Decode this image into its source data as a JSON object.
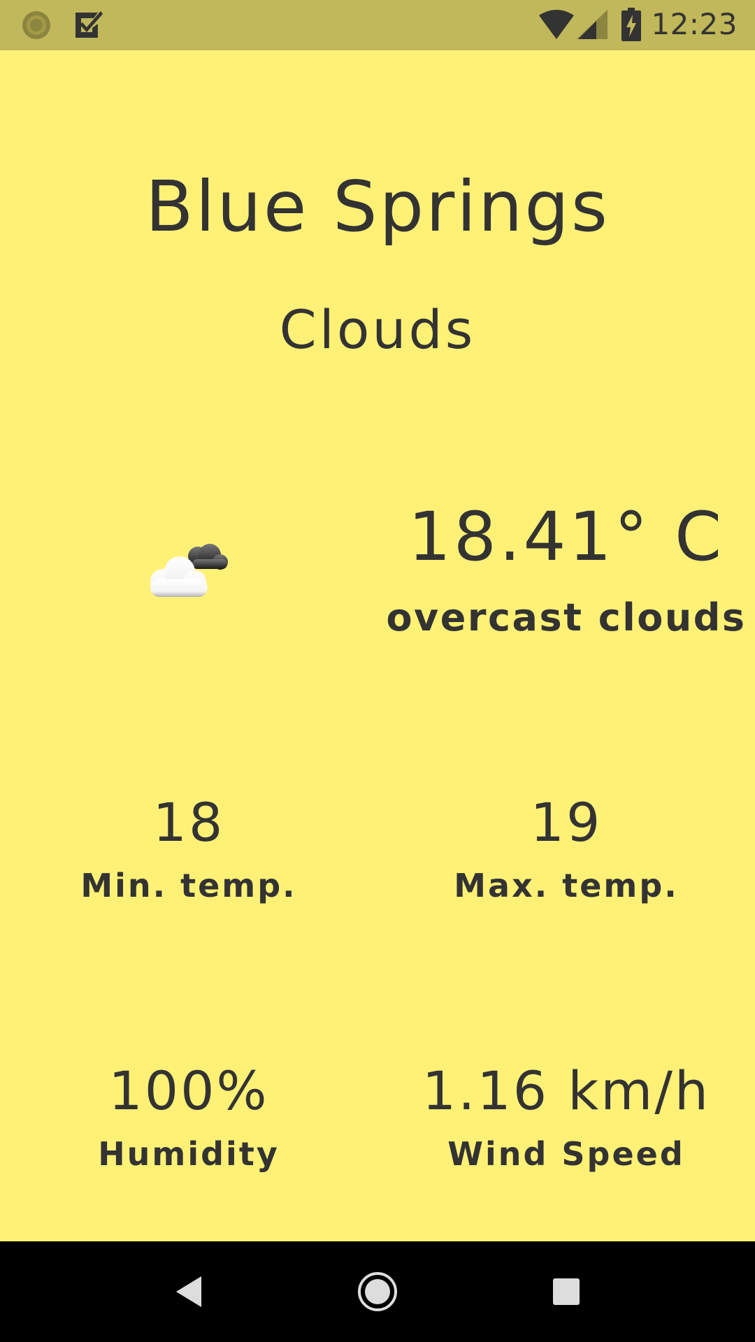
{
  "status_bar": {
    "time": "12:23",
    "icons": [
      "app-notification-icon",
      "checkbox-icon",
      "wifi-icon",
      "signal-icon",
      "battery-charging-icon"
    ]
  },
  "weather": {
    "city": "Blue Springs",
    "condition": "Clouds",
    "temperature": "18.41° C",
    "description": "overcast clouds",
    "icon": "overcast-clouds-icon"
  },
  "stats": {
    "min_temp": {
      "value": "18",
      "label": "Min. temp."
    },
    "max_temp": {
      "value": "19",
      "label": "Max. temp."
    },
    "humidity": {
      "value": "100%",
      "label": "Humidity"
    },
    "wind": {
      "value": "1.16 km/h",
      "label": "Wind Speed"
    }
  },
  "nav_bar": {
    "buttons": [
      "back-icon",
      "home-icon",
      "recents-icon"
    ]
  },
  "colors": {
    "background": "#FFF176",
    "status_bar": "#C0B85A",
    "text": "#333333",
    "nav_bar": "#000000"
  }
}
